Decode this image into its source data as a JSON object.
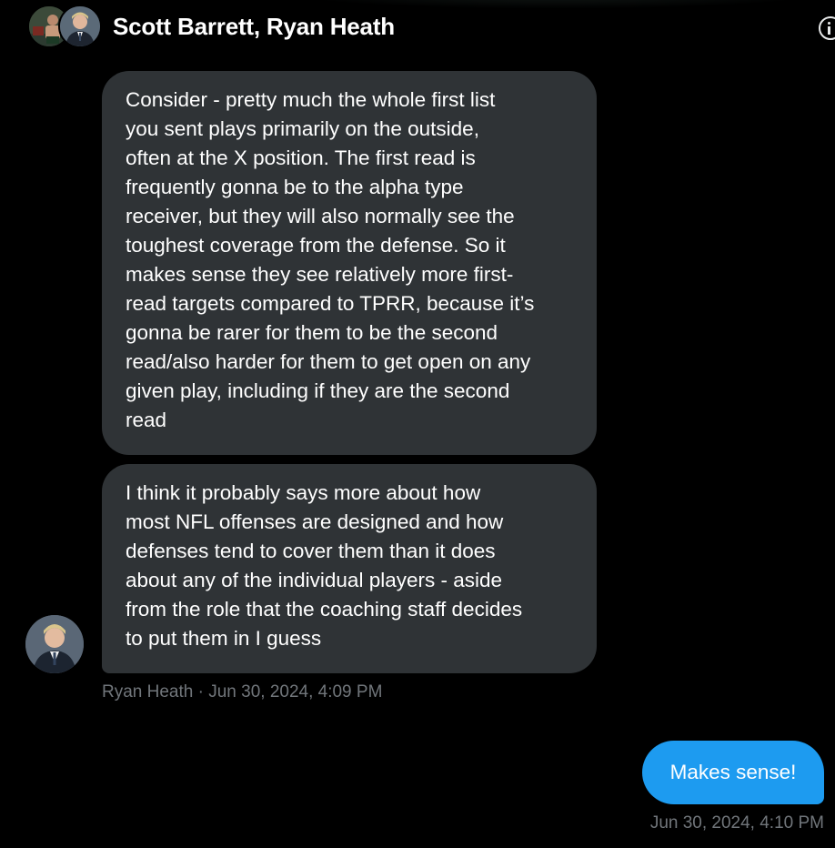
{
  "conversation": {
    "title": "Scott Barrett, Ryan Heath",
    "info_icon": "info-icon",
    "participant_avatars": [
      "scott-barrett-avatar",
      "ryan-heath-avatar"
    ]
  },
  "messages": [
    {
      "direction": "incoming",
      "lines": [
        "Consider - pretty much the whole first list",
        "you sent plays primarily on the outside,",
        "often at the X position. The first read is",
        "frequently gonna be to the alpha type",
        "receiver, but they will also normally see the",
        "toughest coverage from the defense. So it",
        "makes sense they see relatively more first-",
        "read targets compared to TPRR, because it’s",
        "gonna be rarer for them to be the second",
        "read/also harder for them to get open on any",
        "given play, including if they are the second",
        "read"
      ]
    },
    {
      "direction": "incoming",
      "lines": [
        "I think it probably says more about how",
        "most NFL offenses are designed and how",
        "defenses tend to cover them than it does",
        "about any of the individual players - aside",
        "from the role that the coaching staff decides",
        "to put them in I guess"
      ],
      "meta": "Ryan Heath · Jun 30, 2024, 4:09 PM"
    },
    {
      "direction": "outgoing",
      "text": "Makes sense!",
      "meta": "Jun 30, 2024, 4:10 PM"
    }
  ],
  "colors": {
    "background": "#000000",
    "incoming_bubble": "#2f3336",
    "outgoing_bubble": "#1d9bf0",
    "meta_text": "#71767b"
  }
}
